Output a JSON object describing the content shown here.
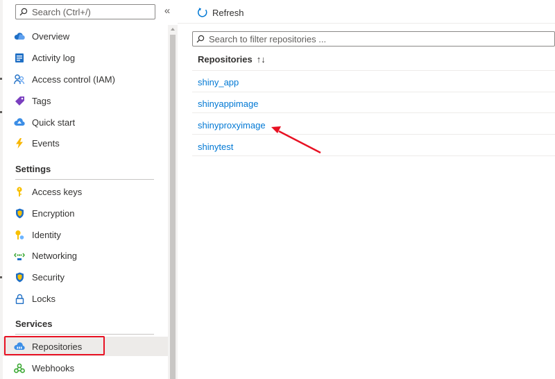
{
  "sidebar": {
    "search_placeholder": "Search (Ctrl+/)",
    "collapse_glyph": "«",
    "items": [
      {
        "label": "Overview",
        "icon": "cloud-icon"
      },
      {
        "label": "Activity log",
        "icon": "log-icon"
      },
      {
        "label": "Access control (IAM)",
        "icon": "people-icon"
      },
      {
        "label": "Tags",
        "icon": "tag-icon"
      },
      {
        "label": "Quick start",
        "icon": "quickstart-cloud-icon"
      },
      {
        "label": "Events",
        "icon": "lightning-icon"
      }
    ],
    "settings": {
      "title": "Settings",
      "items": [
        {
          "label": "Access keys",
          "icon": "key-icon"
        },
        {
          "label": "Encryption",
          "icon": "shield-icon"
        },
        {
          "label": "Identity",
          "icon": "identity-key-icon"
        },
        {
          "label": "Networking",
          "icon": "network-icon"
        },
        {
          "label": "Security",
          "icon": "shield-icon"
        },
        {
          "label": "Locks",
          "icon": "lock-icon"
        }
      ]
    },
    "services": {
      "title": "Services",
      "items": [
        {
          "label": "Repositories",
          "icon": "repository-cloud-icon",
          "selected": true
        },
        {
          "label": "Webhooks",
          "icon": "webhook-icon"
        }
      ]
    }
  },
  "content": {
    "refresh_label": "Refresh",
    "filter_placeholder": "Search to filter repositories ...",
    "column_header": "Repositories",
    "sort_glyph": "↑↓",
    "repositories": [
      "shiny_app",
      "shinyappimage",
      "shinyproxyimage",
      "shinytest"
    ]
  },
  "colors": {
    "link": "#0078d4",
    "annotation_red": "#e81123",
    "selected_bg": "#edebe9"
  }
}
